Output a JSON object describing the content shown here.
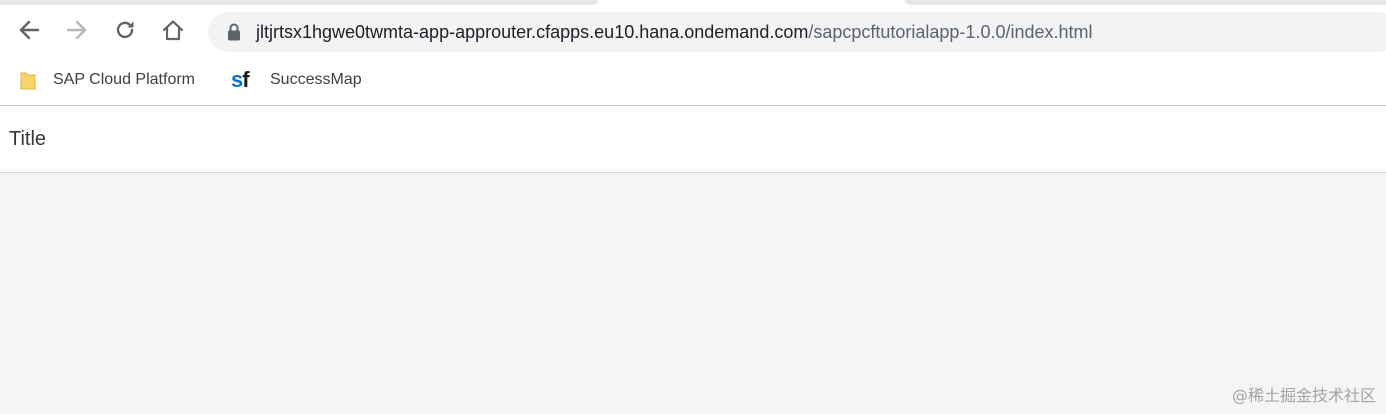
{
  "browser": {
    "url_host": "jltjrtsx1hgwe0twmta-app-approuter.cfapps.eu10.hana.ondemand.com",
    "url_path": "/sapcpcftutorialapp-1.0.0/index.html",
    "nav_icons": [
      "back-arrow-icon",
      "forward-arrow-icon",
      "reload-icon",
      "home-icon"
    ],
    "secure_icon": "lock-icon"
  },
  "bookmarks": [
    {
      "label": "SAP Cloud Platform",
      "icon": "folder-icon"
    },
    {
      "label": "SuccessMap",
      "icon": "sf-logo-icon",
      "logo_text": "sf"
    }
  ],
  "app": {
    "title": "Title"
  },
  "watermark": "@稀土掘金技术社区",
  "colors": {
    "omnibox_bg": "#f1f3f4",
    "page_bg": "#f5f5f5",
    "folder_yellow": "#f7d36b",
    "sf_blue": "#0a6ed1"
  }
}
